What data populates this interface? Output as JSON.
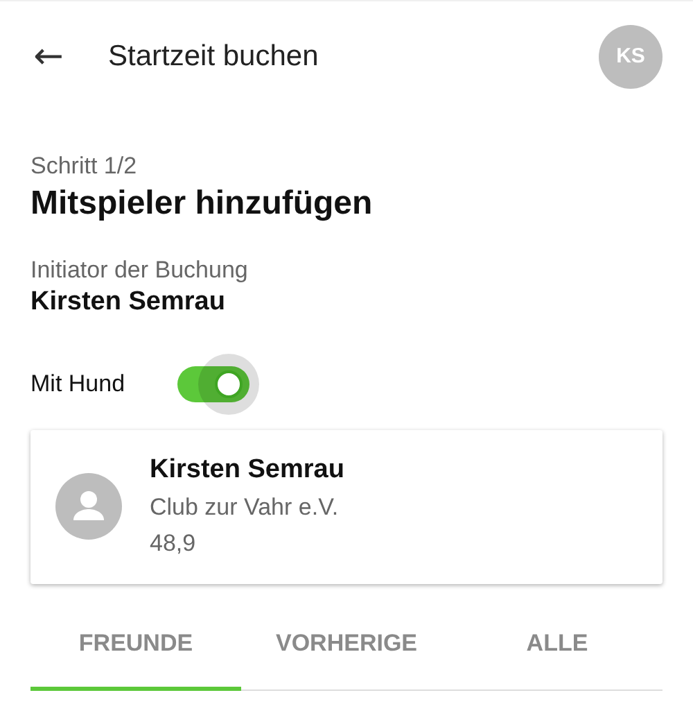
{
  "header": {
    "back_icon": "←",
    "title": "Startzeit buchen",
    "avatar_initials": "KS"
  },
  "step": {
    "label": "Schritt 1/2",
    "title": "Mitspieler hinzufügen"
  },
  "initiator": {
    "label": "Initiator der Buchung",
    "name": "Kirsten Semrau"
  },
  "dog_toggle": {
    "label": "Mit Hund",
    "on": true
  },
  "player_card": {
    "name": "Kirsten Semrau",
    "club": "Club zur Vahr e.V.",
    "handicap": "48,9"
  },
  "tabs": [
    {
      "label": "FREUNDE",
      "selected": true
    },
    {
      "label": "VORHERIGE",
      "selected": false
    },
    {
      "label": "ALLE",
      "selected": false
    }
  ]
}
